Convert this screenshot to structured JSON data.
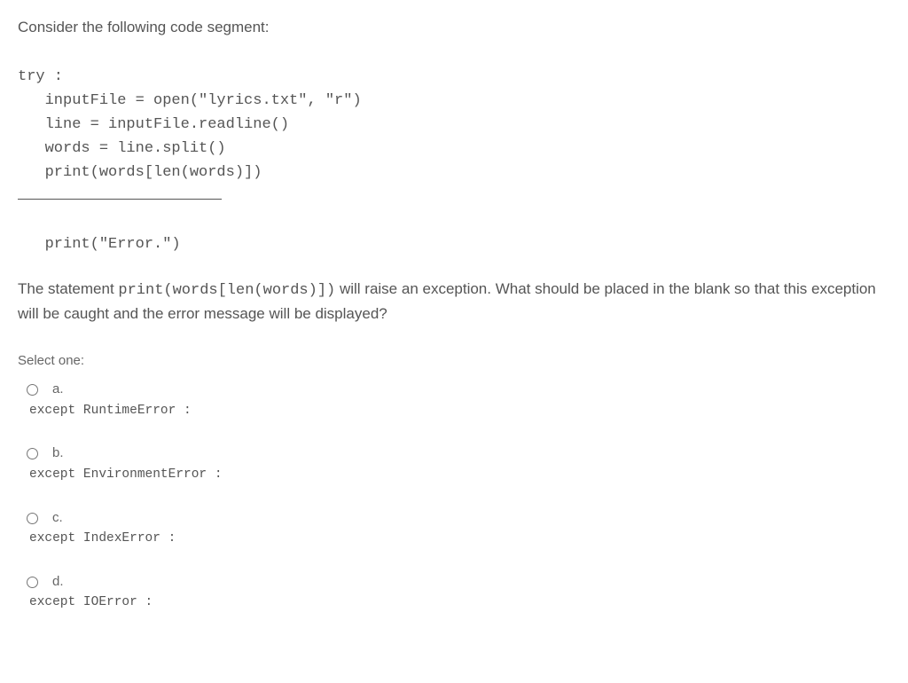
{
  "intro": "Consider the following code segment:",
  "code": {
    "l1": "try :",
    "l2": "   inputFile = open(\"lyrics.txt\", \"r\")",
    "l3": "   line = inputFile.readline()",
    "l4": "   words = line.split()",
    "l5": "   print(words[len(words)])",
    "l6": "   print(\"Error.\")"
  },
  "question": {
    "pre": "The statement ",
    "mono": "print(words[len(words)])",
    "post": " will raise an exception. What should be placed in the blank so that this exception will be caught and the error message will be displayed?"
  },
  "select_one": "Select one:",
  "options": [
    {
      "letter": "a.",
      "code": "except RuntimeError :"
    },
    {
      "letter": "b.",
      "code": "except EnvironmentError :"
    },
    {
      "letter": "c.",
      "code": "except IndexError :"
    },
    {
      "letter": "d.",
      "code": "except IOError :"
    }
  ]
}
